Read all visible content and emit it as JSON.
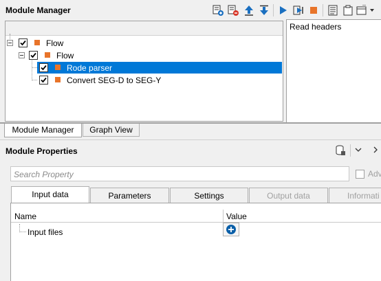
{
  "module_manager": {
    "title": "Module Manager",
    "toolbar_icons": [
      "add-module-icon",
      "remove-module-icon",
      "move-up-icon",
      "move-down-icon",
      "run-icon",
      "step-icon",
      "stop-icon",
      "log-icon",
      "clipboard-icon",
      "window-menu-icon"
    ],
    "tree": {
      "root": "Flow",
      "child": "Flow",
      "items": [
        "Rode parser",
        "Convert SEG-D to SEG-Y"
      ]
    },
    "right_panel_text": "Read headers"
  },
  "bottom_tabs": [
    "Module Manager",
    "Graph View"
  ],
  "module_properties": {
    "title": "Module Properties",
    "search_placeholder": "Search Property",
    "advanced_label": "Adv",
    "tabs": [
      "Input data",
      "Parameters",
      "Settings",
      "Output data",
      "Informati"
    ],
    "grid": {
      "col_name": "Name",
      "col_value": "Value",
      "rows": [
        {
          "name": "Input files"
        }
      ]
    }
  },
  "colors": {
    "selection": "#0078d7",
    "module_square": "#e8742a",
    "accent": "#0a5fa8"
  }
}
